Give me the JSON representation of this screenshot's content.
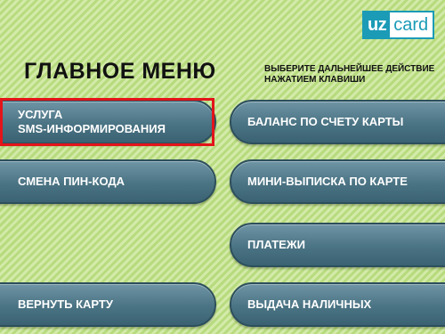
{
  "logo": {
    "part1": "uz",
    "part2": "card"
  },
  "title": "ГЛАВНОЕ МЕНЮ",
  "hint": "ВЫБЕРИТЕ ДАЛЬНЕЙШЕЕ ДЕЙСТВИЕ\nНАЖАТИЕМ КЛАВИШИ",
  "buttons": {
    "sms": "УСЛУГА\nSMS-ИНФОРМИРОВАНИЯ",
    "pin": "СМЕНА ПИН-КОДА",
    "return_card": "ВЕРНУТЬ КАРТУ",
    "balance": "БАЛАНС ПО СЧЕТУ КАРТЫ",
    "mini_statement": "МИНИ-ВЫПИСКА ПО КАРТЕ",
    "payments": "ПЛАТЕЖИ",
    "cash": "ВЫДАЧА НАЛИЧНЫХ"
  },
  "colors": {
    "highlight": "#e3141a",
    "brand": "#1b9bb6",
    "button": "#4a7383"
  }
}
